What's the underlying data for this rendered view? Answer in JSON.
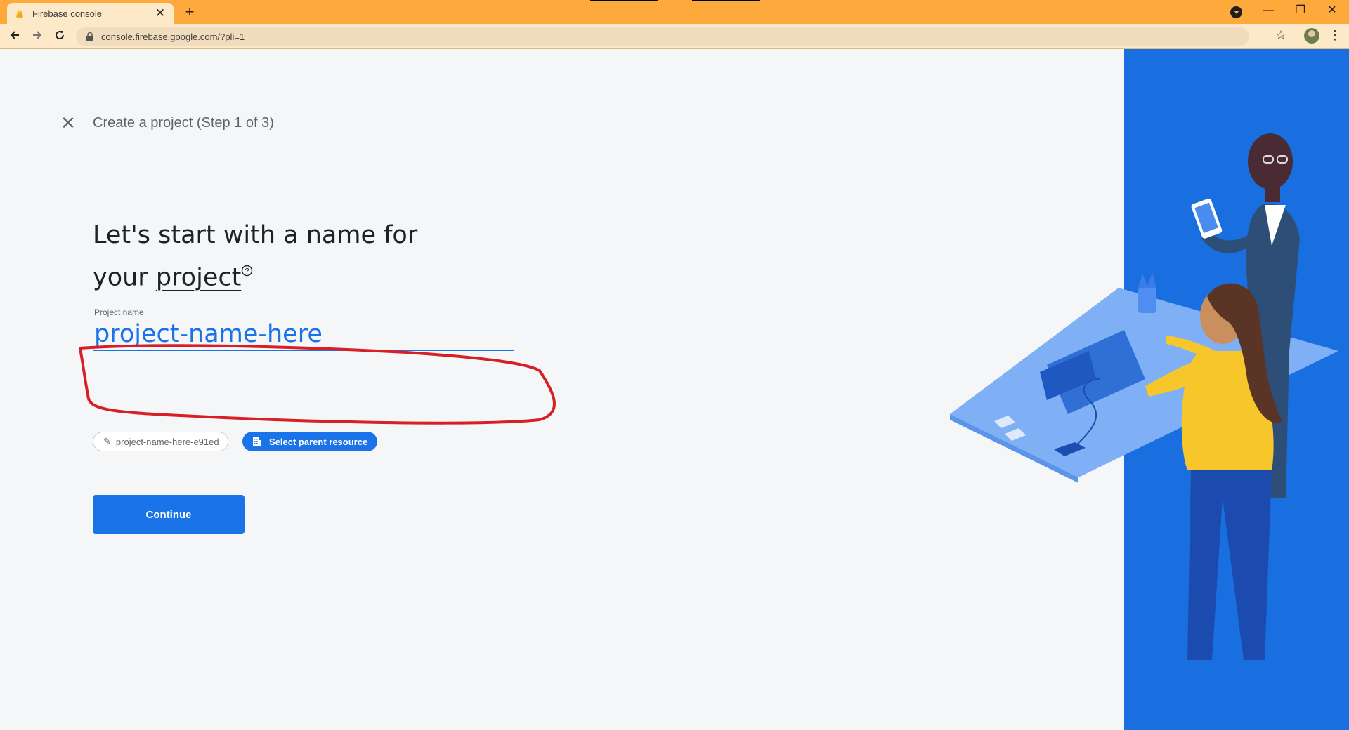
{
  "browser": {
    "tab_title": "Firebase console",
    "tab_close": "✕",
    "new_tab": "+",
    "url": "console.firebase.google.com/?pli=1",
    "window_controls": [
      "—",
      "❐",
      "✕"
    ]
  },
  "page": {
    "close_label": "✕",
    "step_title": "Create a project (Step 1 of 3)",
    "heading_line1": "Let's start with a name for",
    "heading_your": "your",
    "heading_project": "project",
    "help_glyph": "?",
    "project_name_label": "Project name",
    "project_name_value": "project-name-here",
    "project_id_chip": "project-name-here-e91ed",
    "parent_resource_button": "Select parent resource",
    "continue_button": "Continue"
  },
  "colors": {
    "accent": "#1a73e8",
    "titlebar": "#fea93c",
    "annotation": "#d81f26",
    "illustration_bg": "#1a6fe0"
  },
  "icons": [
    "firebase-flame-icon",
    "close-icon",
    "plus-icon",
    "back-arrow-icon",
    "forward-arrow-icon",
    "reload-icon",
    "lock-icon",
    "star-icon",
    "profile-avatar",
    "more-vert-icon",
    "help-icon",
    "pencil-icon",
    "building-icon"
  ]
}
